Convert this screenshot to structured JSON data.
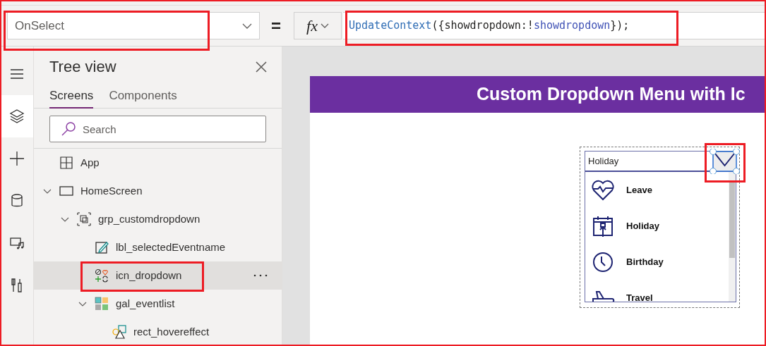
{
  "property_dropdown": {
    "value": "OnSelect"
  },
  "equals": "=",
  "fx_button": {
    "label": "fx"
  },
  "formula": [
    {
      "kind": "function",
      "text": "UpdateContext"
    },
    {
      "kind": "plain",
      "text": "({showdropdown:!"
    },
    {
      "kind": "variable",
      "text": "showdropdown"
    },
    {
      "kind": "plain",
      "text": "});"
    }
  ],
  "rail": [
    {
      "kind": "menu",
      "selected": false
    },
    {
      "kind": "layers",
      "selected": true
    },
    {
      "kind": "plus",
      "selected": false
    },
    {
      "kind": "database",
      "selected": false
    },
    {
      "kind": "media",
      "selected": false
    },
    {
      "kind": "tools",
      "selected": false
    }
  ],
  "tree_view": {
    "title": "Tree view",
    "tabs": [
      {
        "label": "Screens",
        "selected": true
      },
      {
        "label": "Components",
        "selected": false
      }
    ],
    "search": {
      "placeholder": "Search"
    },
    "items": [
      {
        "kind": "app",
        "label": "App",
        "selected": false
      },
      {
        "kind": "screen",
        "label": "HomeScreen",
        "expanded": true,
        "selected": false,
        "children": [
          {
            "kind": "group",
            "label": "grp_customdropdown",
            "expanded": true,
            "selected": false,
            "children": [
              {
                "kind": "label",
                "label": "lbl_selectedEventname",
                "selected": false
              },
              {
                "kind": "icon",
                "label": "icn_dropdown",
                "selected": true
              },
              {
                "kind": "gallery",
                "label": "gal_eventlist",
                "expanded": true,
                "selected": false,
                "children": [
                  {
                    "kind": "shape",
                    "label": "rect_hovereffect",
                    "selected": false
                  }
                ]
              }
            ]
          }
        ]
      }
    ]
  },
  "canvas": {
    "header": "Custom Dropdown Menu with Ic",
    "dropdown": {
      "selected_value": "Holiday",
      "items": [
        {
          "kind": "heart",
          "label": "Leave"
        },
        {
          "kind": "calendar",
          "label": "Holiday"
        },
        {
          "kind": "clock",
          "label": "Birthday"
        },
        {
          "kind": "plane",
          "label": "Travel"
        }
      ]
    }
  }
}
